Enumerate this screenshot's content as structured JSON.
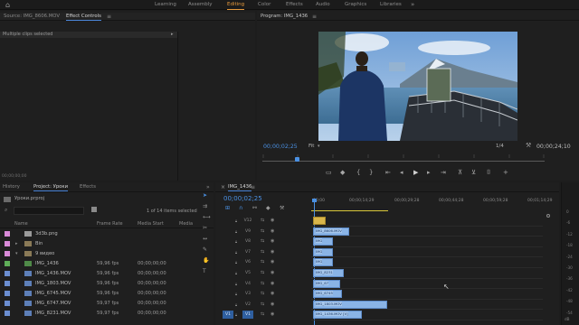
{
  "topbar": {
    "tabs": [
      {
        "label": "Learning"
      },
      {
        "label": "Assembly"
      },
      {
        "label": "Editing"
      },
      {
        "label": "Color"
      },
      {
        "label": "Effects"
      },
      {
        "label": "Audio"
      },
      {
        "label": "Graphics"
      },
      {
        "label": "Libraries"
      }
    ],
    "more": "»"
  },
  "source_panel": {
    "tab_source": "Source: IMG_8606.MOV",
    "tab_effects": "Effect Controls",
    "menu": "≡",
    "clips_msg": "Multiple clips selected",
    "timecode": "00;00;00;00"
  },
  "program": {
    "title": "Program: IMG_1436",
    "menu": "≡",
    "timecode_current": "00;00;02;25",
    "fit": "Fit",
    "fit_arrow": "▾",
    "scale": "1/4",
    "wrench": "⚒",
    "timecode_duration": "00;00;24;10"
  },
  "project_panel": {
    "tab_history": "History",
    "tab_project": "Project: Уроки",
    "tab_effects": "Effects",
    "more": "»",
    "file": "Уроки.prproj",
    "items_count": "1 of 14 items selected",
    "columns": {
      "name": "Name",
      "frame_rate": "Frame Rate",
      "media_start": "Media Start",
      "media_end": "Media"
    },
    "rows": [
      {
        "name": "3d3b.png",
        "fps": "",
        "start": "",
        "color": "#d98ad8",
        "type": "image"
      },
      {
        "name": "Bin",
        "fps": "",
        "start": "",
        "color": "#d98ad8",
        "type": "bin"
      },
      {
        "name": "9 видео",
        "fps": "",
        "start": "",
        "color": "#d98ad8",
        "type": "bin"
      },
      {
        "name": "IMG_1436",
        "fps": "59,96 fps",
        "start": "00;00;00;00",
        "color": "#5fae58",
        "type": "seq"
      },
      {
        "name": "IMG_1436.MOV",
        "fps": "59,96 fps",
        "start": "00;00;00;00",
        "color": "#6b8ed1",
        "type": "clip"
      },
      {
        "name": "IMG_1803.MOV",
        "fps": "59,96 fps",
        "start": "00;00;00;00",
        "color": "#6b8ed1",
        "type": "clip"
      },
      {
        "name": "IMG_6745.MOV",
        "fps": "59,96 fps",
        "start": "00;00;00;00",
        "color": "#6b8ed1",
        "type": "clip"
      },
      {
        "name": "IMG_6747.MOV",
        "fps": "59,97 fps",
        "start": "00;00;00;00",
        "color": "#6b8ed1",
        "type": "clip"
      },
      {
        "name": "IMG_8231.MOV",
        "fps": "59,97 fps",
        "start": "00;00;00;00",
        "color": "#6b8ed1",
        "type": "clip"
      }
    ]
  },
  "timeline": {
    "tab": "IMG_1436",
    "menu": "≡",
    "timecode": "00;00;02;25",
    "ruler": [
      "00;00",
      "00;00;14;29",
      "00;00;29;28",
      "00;00;44;28",
      "00;00;59;28",
      "00;01;14;29"
    ],
    "tracks": [
      {
        "name": "V12",
        "clip": ""
      },
      {
        "name": "V9",
        "clip": "IMG_8606.MOV"
      },
      {
        "name": "V8",
        "clip": "IMG"
      },
      {
        "name": "V7",
        "clip": "IMG"
      },
      {
        "name": "V6",
        "clip": "IMG"
      },
      {
        "name": "V5",
        "clip": "IMG_8231"
      },
      {
        "name": "V4",
        "clip": "IMG_67"
      },
      {
        "name": "V3",
        "clip": "IMG_6745"
      },
      {
        "name": "V2",
        "clip": "IMG_1803.MOV"
      },
      {
        "name": "V1",
        "clip": "IMG_1436.MOV [V]"
      }
    ],
    "src_patch": "V1",
    "meter": [
      "0",
      "-6",
      "-12",
      "-18",
      "-24",
      "-30",
      "-36",
      "-42",
      "-48",
      "-54"
    ],
    "meter_unit": "dB"
  },
  "colors": {
    "accent": "#e79a3c",
    "blue": "#4a90e2",
    "clip": "#8ab4e6"
  }
}
